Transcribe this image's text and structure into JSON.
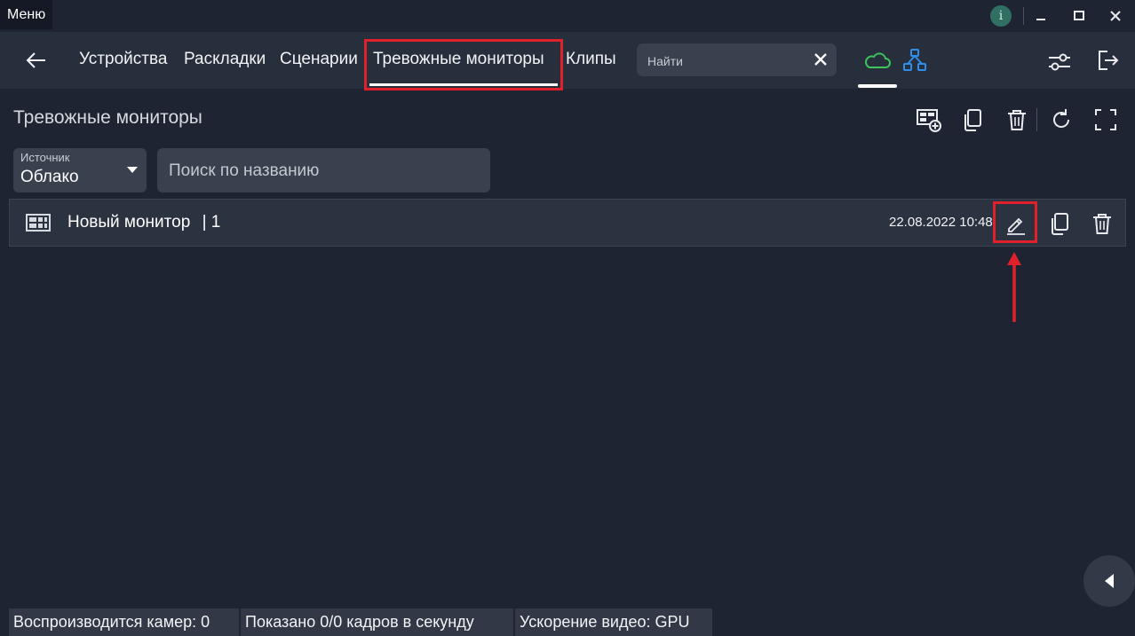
{
  "titlebar": {
    "menu_label": "Меню",
    "info_label": "i"
  },
  "nav": {
    "items": [
      "Устройства",
      "Раскладки",
      "Сценарии",
      "Тревожные мониторы",
      "Клипы"
    ],
    "active_index": 3,
    "search_placeholder": "Найти"
  },
  "page": {
    "title": "Тревожные мониторы"
  },
  "filters": {
    "source_label": "Источник",
    "source_value": "Облако",
    "name_search_placeholder": "Поиск по названию"
  },
  "list": [
    {
      "title": "Новый монитор",
      "count_label": "| 1",
      "date": "22.08.2022 10:48"
    }
  ],
  "status": {
    "playing": "Воспроизводится камер: 0",
    "fps": "Показано 0/0 кадров в секунду",
    "accel": "Ускорение видео: GPU"
  },
  "colors": {
    "background": "#1e2431",
    "navbar": "#272e3c",
    "highlight": "#e0212b",
    "cloud": "#3ec45a",
    "network": "#2f8ee8"
  }
}
